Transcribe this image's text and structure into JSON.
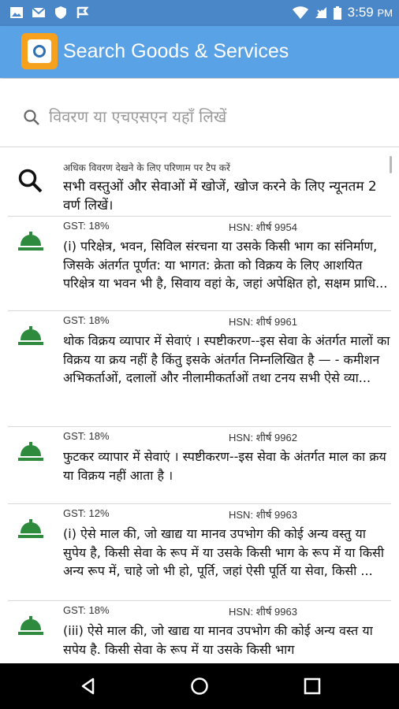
{
  "status_bar": {
    "left_icons": [
      "image-icon",
      "mail-icon",
      "shield-icon",
      "flag-icon"
    ],
    "right_icons": [
      "wifi-icon",
      "no-sim-icon",
      "battery-icon"
    ],
    "time": "3:59",
    "ampm": "PM"
  },
  "app_bar": {
    "title": "Search Goods & Services",
    "logo_icon": "app-logo-icon",
    "color": "#5aa2e6",
    "logo_color": "#f6a11e"
  },
  "search": {
    "placeholder": "विवरण या एचएसएन यहाँ लिखें",
    "icon": "search-icon"
  },
  "hint": {
    "small": "अधिक विवरण देखने के लिए परिणाम पर टैप करें",
    "text": "सभी वस्तुओं और सेवाओं में खोजें, खोज करने के लिए न्यूनतम 2 वर्ण लिखें।"
  },
  "results": [
    {
      "gst": "GST: 18%",
      "hsn": "HSN: शीर्ष 9954",
      "description": "(i)  परिक्षेत्र, भवन, सिविल संरचना या उसके  किसी भाग का संनिर्माण,  जिसके अंतर्गत पूर्णत: या भागत: क्रेता को विक्रय के लिए आशयित परिक्षेत्र या भवन भी है, सिवाय वहां के, जहां अपेक्षित हो, सक्षम प्राधि..."
    },
    {
      "gst": "GST: 18%",
      "hsn": "HSN: शीर्ष 9961",
      "description": "थोक विक्रय व्यापार में सेवाएं । स्पष्टीकरण--इस सेवा के अंतर्गत मालों का विक्रय या क्रय नहीं है किंतु इसके अंतर्गत निम्नलिखित है — - कमीशन अभिकर्ताओं, दलालों और नीलामीकर्ताओं तथा टनय सभी ऐसे व्या..."
    },
    {
      "gst": "GST: 18%",
      "hsn": "HSN: शीर्ष 9962",
      "description": "फुटकर व्यापार में सेवाएं । स्पष्टीकरण--इस सेवा के अंतर्गत माल का क्रय या विक्रय नहीं आता है ।"
    },
    {
      "gst": "GST: 12%",
      "hsn": "HSN: शीर्ष 9963",
      "description": "(i)  ऐसे माल की, जो खाद्य  या मानव उपभोग की कोई अन्य वस्तु या सुपेय है, किसी सेवा के रूप में या उसके किसी भाग के रूप में या किसी अन्य रूप में, चाहे जो भी हो, पूर्ति, जहां ऐसी पूर्ति या सेवा, किसी ..."
    },
    {
      "gst": "GST: 18%",
      "hsn": "HSN: शीर्ष 9963",
      "description": "(iii)  ऐसे माल की, जो खाद्य  या मानव उपभोग की कोई अन्य वस्त या सपेय है. किसी सेवा के रूप में या उसके किसी भाग"
    }
  ],
  "result_icon": "service-bell-icon",
  "result_icon_color": "#2e8b3e",
  "nav_bar": {
    "buttons": [
      "back-icon",
      "home-icon",
      "recents-icon"
    ]
  }
}
